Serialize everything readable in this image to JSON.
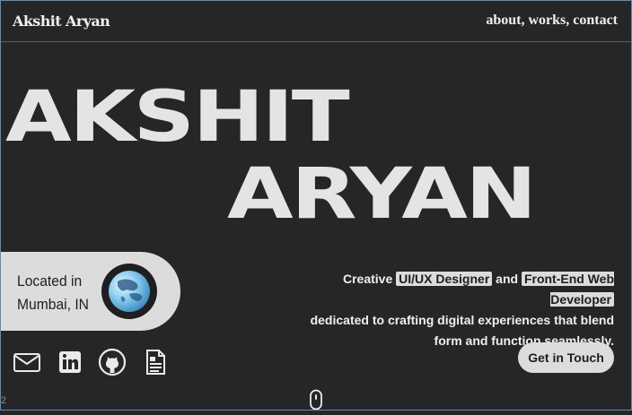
{
  "header": {
    "logo": "Akshit Aryan",
    "nav": [
      "about",
      "works",
      "contact"
    ],
    "nav_separator": ", "
  },
  "hero": {
    "line1": "AKSHIT",
    "line2": "ARYAN"
  },
  "location": {
    "line1": "Located in",
    "line2": "Mumbai, IN",
    "icon": "globe-icon"
  },
  "tagline": {
    "prefix": "Creative ",
    "highlight1": "UI/UX Designer",
    "middle": " and ",
    "highlight2": "Front-End Web Developer",
    "rest": "dedicated to crafting digital experiences that blend form and function seamlessly."
  },
  "cta": {
    "label": "Get in Touch"
  },
  "socials": [
    {
      "icon": "mail-icon"
    },
    {
      "icon": "linkedin-icon"
    },
    {
      "icon": "github-icon"
    },
    {
      "icon": "resume-icon"
    }
  ],
  "footer": {
    "page_number": "2",
    "scroll_icon": "mouse-scroll-icon"
  },
  "colors": {
    "background": "#262626",
    "text": "#e8e8e8",
    "accent_surface": "#dcdcdc"
  }
}
